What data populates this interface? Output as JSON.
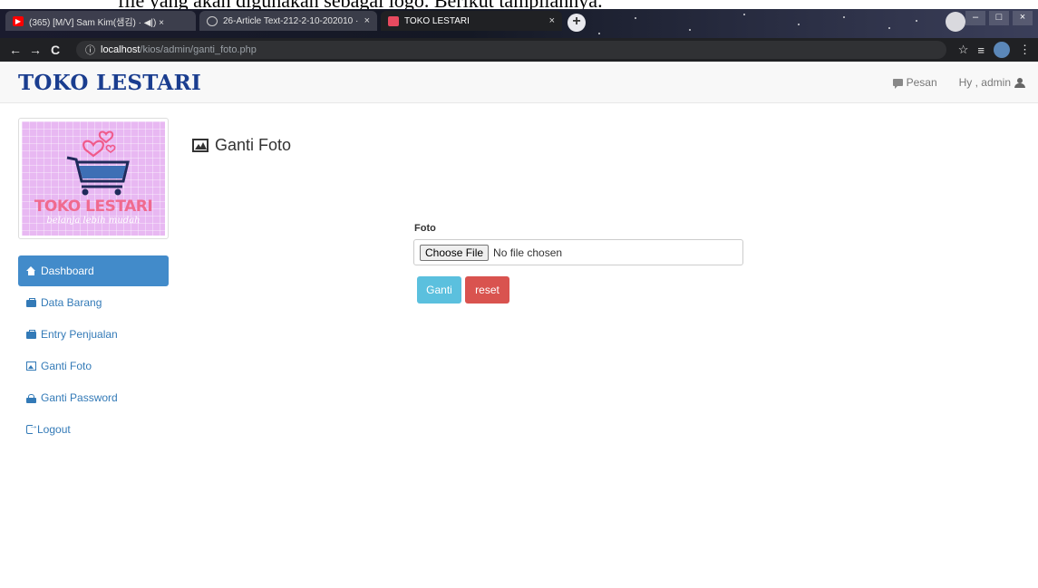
{
  "doc_caption": "file yang akan digunakan sebagai logo. Berikut tampilannya.",
  "browser": {
    "tabs": [
      {
        "label": "(365) [M/V] Sam Kim(샘김) ·  ◀|) ×",
        "favicon": "youtube-icon",
        "favicon_color": "#ff0000"
      },
      {
        "label": "26-Article Text-212-2-10-202010 ·",
        "favicon": "globe-icon",
        "favicon_color": "#cccccc"
      },
      {
        "label": "TOKO LESTARI",
        "favicon": "page-icon",
        "favicon_color": "#e84a5f"
      }
    ],
    "tab_close": "×",
    "new_tab": "+",
    "url_host": "localhost",
    "url_path": "/kios/admin/ganti_foto.php",
    "info_icon": "ⓘ"
  },
  "navbar": {
    "brand": "TOKO LESTARI",
    "messages_label": "Pesan",
    "user_label": "Hy , admin"
  },
  "logo": {
    "title": "TOKO LESTARI",
    "subtitle": "belanja lebih mudah"
  },
  "sidebar": {
    "items": [
      {
        "label": "Dashboard",
        "icon": "home-icon",
        "active": true
      },
      {
        "label": "Data Barang",
        "icon": "briefcase-icon",
        "active": false
      },
      {
        "label": "Entry Penjualan",
        "icon": "briefcase-icon",
        "active": false
      },
      {
        "label": "Ganti Foto",
        "icon": "picture-icon",
        "active": false
      },
      {
        "label": "Ganti Password",
        "icon": "lock-icon",
        "active": false
      },
      {
        "label": "Logout",
        "icon": "logout-icon",
        "active": false
      }
    ]
  },
  "main": {
    "title": "Ganti Foto",
    "form": {
      "label": "Foto",
      "choose_button": "Choose File",
      "file_status": "No file chosen",
      "submit_label": "Ganti",
      "reset_label": "reset"
    }
  },
  "colors": {
    "brand": "#1a3d8f",
    "active_menu": "#428bca",
    "link": "#337ab7",
    "btn_info": "#5bc0de",
    "btn_danger": "#d9534f"
  }
}
